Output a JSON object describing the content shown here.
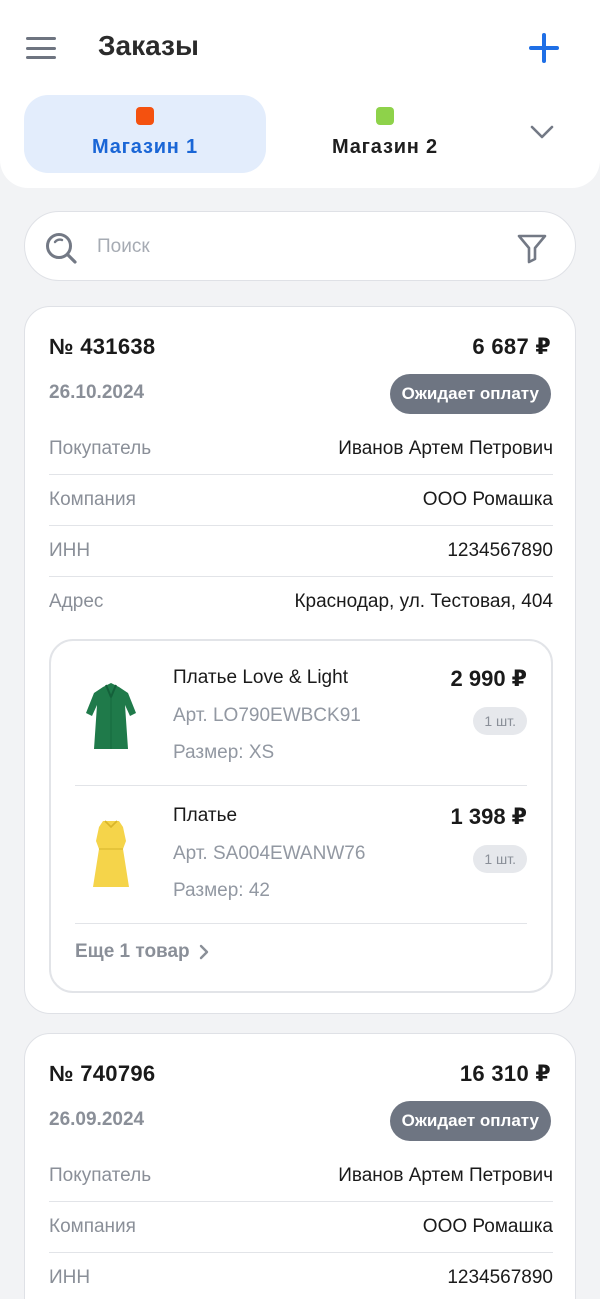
{
  "header": {
    "title": "Заказы"
  },
  "stores": [
    {
      "label": "Магазин 1",
      "color": "#f4510f",
      "active": true
    },
    {
      "label": "Магазин 2",
      "color": "#8ed24a",
      "active": false
    }
  ],
  "search": {
    "placeholder": "Поиск"
  },
  "orders": [
    {
      "number": "№ 431638",
      "total": "6 687 ₽",
      "date": "26.10.2024",
      "status": "Ожидает оплату",
      "fields": [
        {
          "label": "Покупатель",
          "value": "Иванов Артем Петрович"
        },
        {
          "label": "Компания",
          "value": "ООО Ромашка"
        },
        {
          "label": "ИНН",
          "value": "1234567890"
        },
        {
          "label": "Адрес",
          "value": "Краснодар, ул. Тестовая, 404"
        }
      ],
      "items": [
        {
          "name": "Платье Love & Light",
          "article": "Арт. LO790EWBCK91",
          "size": "Размер: XS",
          "price": "2 990 ₽",
          "qty": "1 шт.",
          "color": "#1f7a4a"
        },
        {
          "name": "Платье",
          "article": "Арт. SA004EWANW76",
          "size": "Размер: 42",
          "price": "1 398 ₽",
          "qty": "1 шт.",
          "color": "#f5d44a"
        }
      ],
      "more": "Еще 1 товар"
    },
    {
      "number": "№ 740796",
      "total": "16 310 ₽",
      "date": "26.09.2024",
      "status": "Ожидает оплату",
      "fields": [
        {
          "label": "Покупатель",
          "value": "Иванов Артем Петрович"
        },
        {
          "label": "Компания",
          "value": "ООО Ромашка"
        },
        {
          "label": "ИНН",
          "value": "1234567890"
        }
      ]
    }
  ]
}
